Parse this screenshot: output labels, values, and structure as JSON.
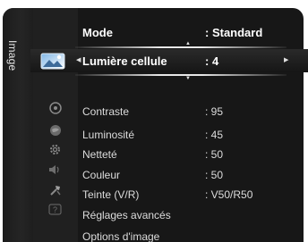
{
  "category": "Image",
  "header": {
    "label": "Mode",
    "value": ": Standard"
  },
  "selected": {
    "label": "Lumière cellule",
    "value": ": 4"
  },
  "items": [
    {
      "label": "Contraste",
      "value": ": 95"
    },
    {
      "label": "Luminosité",
      "value": ": 45"
    },
    {
      "label": "Netteté",
      "value": ": 50"
    },
    {
      "label": "Couleur",
      "value": ": 50"
    },
    {
      "label": "Teinte (V/R)",
      "value": ": V50/R50"
    },
    {
      "label": "Réglages avancés",
      "value": ""
    },
    {
      "label": "Options d'image",
      "value": ""
    }
  ],
  "icons": [
    "picture-icon",
    "disc-icon",
    "globe-icon",
    "gear-icon",
    "speaker-icon",
    "setup-icon",
    "help-icon"
  ]
}
